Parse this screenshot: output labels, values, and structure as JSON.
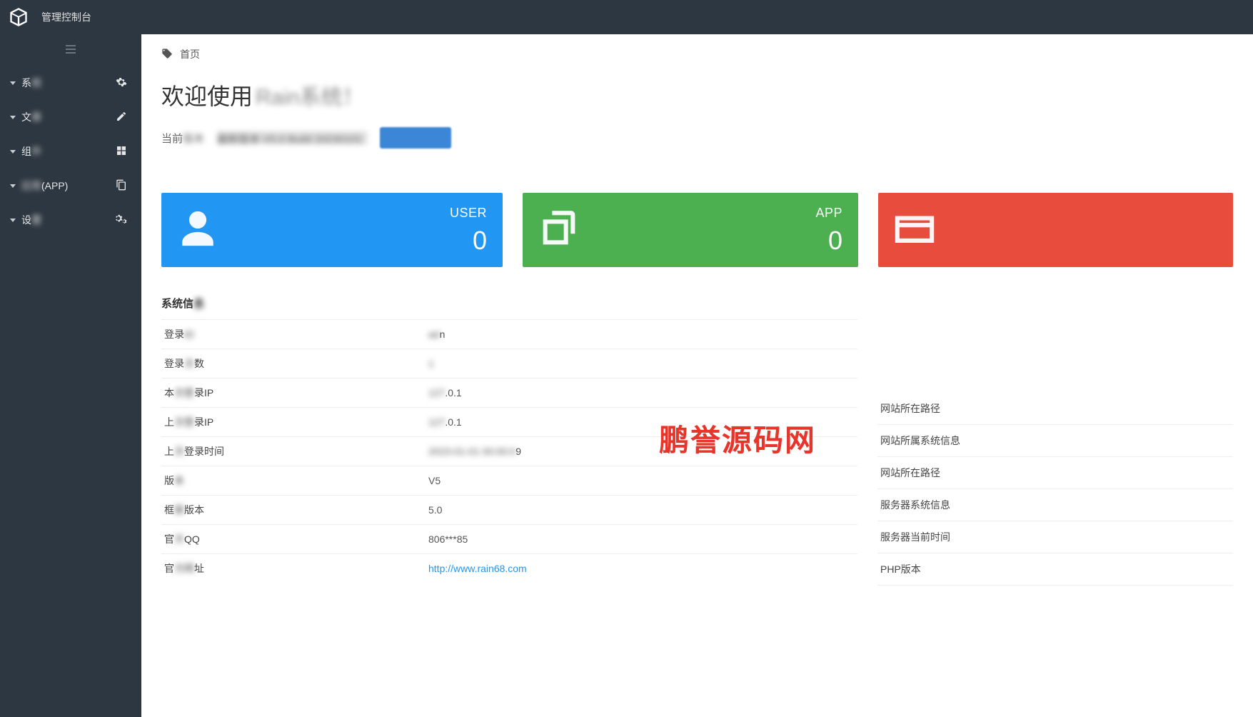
{
  "header": {
    "title": "管理控制台"
  },
  "sidebar": {
    "items": [
      {
        "label": "系",
        "suffix_blur": "统",
        "icon": "gear"
      },
      {
        "label": "文",
        "suffix_blur": "章",
        "icon": "edit"
      },
      {
        "label": "组",
        "suffix_blur": "件",
        "icon": "grid"
      },
      {
        "label": "应用",
        "suffix_blur": "",
        "extra": "(APP)",
        "icon": "copy"
      },
      {
        "label": "设",
        "suffix_blur": "置",
        "icon": "gears"
      }
    ]
  },
  "breadcrumb": {
    "home": "首页"
  },
  "welcome": {
    "prefix": "欢迎使用",
    "blur_tail": "Rain系统！",
    "sub_prefix": "当前",
    "sub_blur1": "版本",
    "sub_blur2": "最新版本 V5.0 Build 20230101"
  },
  "stats": {
    "user": {
      "label": "USER",
      "value": "0"
    },
    "app": {
      "label": "APP",
      "value": "0"
    }
  },
  "system_info": {
    "title": "系统信",
    "title_blur": "息",
    "rows": [
      {
        "k_pre": "登录",
        "k_blur": "ID",
        "v_blur": "ad",
        "v": "n"
      },
      {
        "k_pre": "登录",
        "k_blur": "次",
        "k_post": "数",
        "v_blur": "1",
        "v": ""
      },
      {
        "k_pre": "本",
        "k_blur": "次登",
        "k_post": "录IP",
        "v_blur": "127",
        "v": ".0.1"
      },
      {
        "k_pre": "上",
        "k_blur": "次登",
        "k_post": "录IP",
        "v_blur": "127",
        "v": ".0.1"
      },
      {
        "k_pre": "上",
        "k_blur": "次",
        "k_post": "登录时间",
        "v_blur": "2023-01-01 00:00:0",
        "v": "9"
      },
      {
        "k_pre": "版",
        "k_blur": "本",
        "k_post": "",
        "v_blur": "",
        "v": "V5"
      },
      {
        "k_pre": "框",
        "k_blur": "架",
        "k_post": "版本",
        "v_blur": "",
        "v": "5.0"
      },
      {
        "k_pre": "官",
        "k_blur": "方",
        "k_post": "QQ",
        "v_blur": "",
        "v": "806***85"
      },
      {
        "k_pre": "官",
        "k_blur": "方网",
        "k_post": "址",
        "v_blur": "",
        "v": "http://www.rain68.com",
        "link": true
      }
    ]
  },
  "right_panel": {
    "items": [
      "网站所在路径",
      "网站所属系统信息",
      "网站所在路径",
      "服务器系统信息",
      "服务器当前时间",
      "PHP版本"
    ]
  },
  "watermark": "鹏誉源码网"
}
